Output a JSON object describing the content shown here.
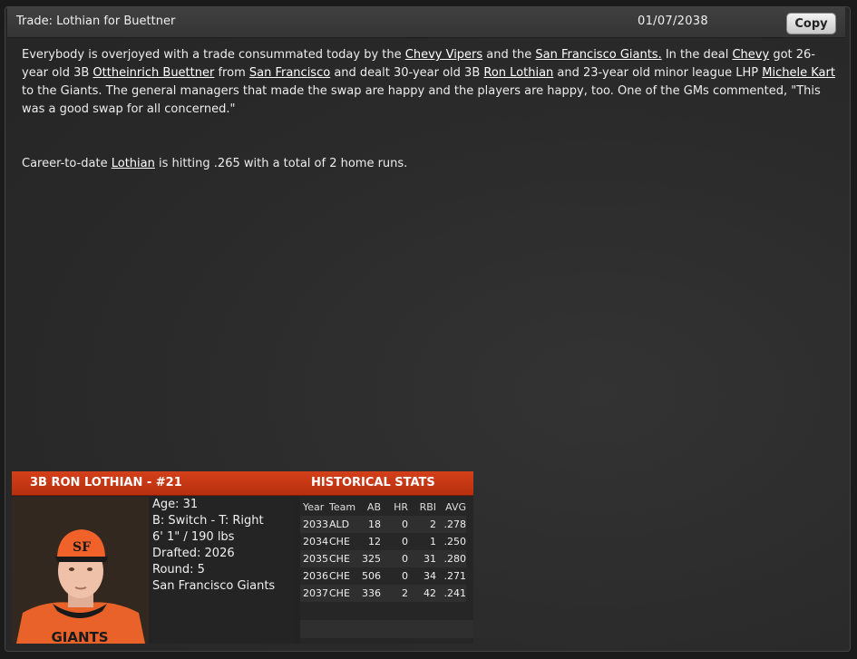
{
  "window": {
    "title": "Trade: Lothian for Buettner",
    "date": "01/07/2038",
    "copy_label": "Copy"
  },
  "article": {
    "p1": {
      "t1": "Everybody is overjoyed with a trade consummated today by the ",
      "l1": "Chevy Vipers",
      "t2": " and the ",
      "l2": "San Francisco Giants.",
      "t3": " In the deal ",
      "l3": "Chevy",
      "t4": " got 26-year old 3B ",
      "l4": "Ottheinrich Buettner",
      "t5": " from ",
      "l5": "San Francisco",
      "t6": " and dealt 30-year old 3B ",
      "l6": "Ron Lothian",
      "t7": " and 23-year old minor league LHP ",
      "l7": "Michele Kart",
      "t8": " to the Giants. The general managers that made the swap are happy and the players are happy, too. One of the GMs commented, \"This was a good swap for all concerned.\""
    },
    "p2": {
      "t1": "Career-to-date ",
      "l1": "Lothian",
      "t2": " is hitting .265 with a total of 2 home runs."
    }
  },
  "player": {
    "header": "3B RON LOTHIAN - #21",
    "age": "Age: 31",
    "bats_throws": "B: Switch - T: Right",
    "height_weight": "6' 1\" / 190 lbs",
    "drafted": "Drafted: 2026",
    "round": "Round: 5",
    "team": "San Francisco Giants"
  },
  "stats": {
    "title": "HISTORICAL STATS",
    "headers": [
      "Year",
      "Team",
      "AB",
      "HR",
      "RBI",
      "AVG"
    ],
    "rows": [
      [
        "2033",
        "ALD",
        "18",
        "0",
        "2",
        ".278"
      ],
      [
        "2034",
        "CHE",
        "12",
        "0",
        "1",
        ".250"
      ],
      [
        "2035",
        "CHE",
        "325",
        "0",
        "31",
        ".280"
      ],
      [
        "2036",
        "CHE",
        "506",
        "0",
        "34",
        ".271"
      ],
      [
        "2037",
        "CHE",
        "336",
        "2",
        "42",
        ".241"
      ]
    ]
  },
  "colors": {
    "accent": "#c9381a",
    "background": "#2a2a2a"
  }
}
